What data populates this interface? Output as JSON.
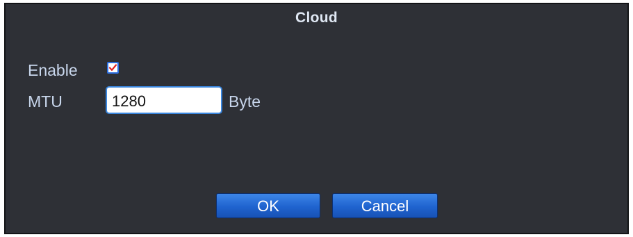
{
  "dialog": {
    "title": "Cloud"
  },
  "enable": {
    "label": "Enable",
    "checked": true,
    "check_icon": "checkmark-icon",
    "check_color": "#e02020"
  },
  "mtu": {
    "label": "MTU",
    "value": "1280",
    "unit": "Byte"
  },
  "buttons": {
    "ok_label": "OK",
    "cancel_label": "Cancel"
  },
  "colors": {
    "dialog_bg": "#2e3036",
    "text": "#c8d6ec",
    "title": "#dfe7f3",
    "button_blue": "#1f63cf",
    "input_border": "#3a86de"
  }
}
